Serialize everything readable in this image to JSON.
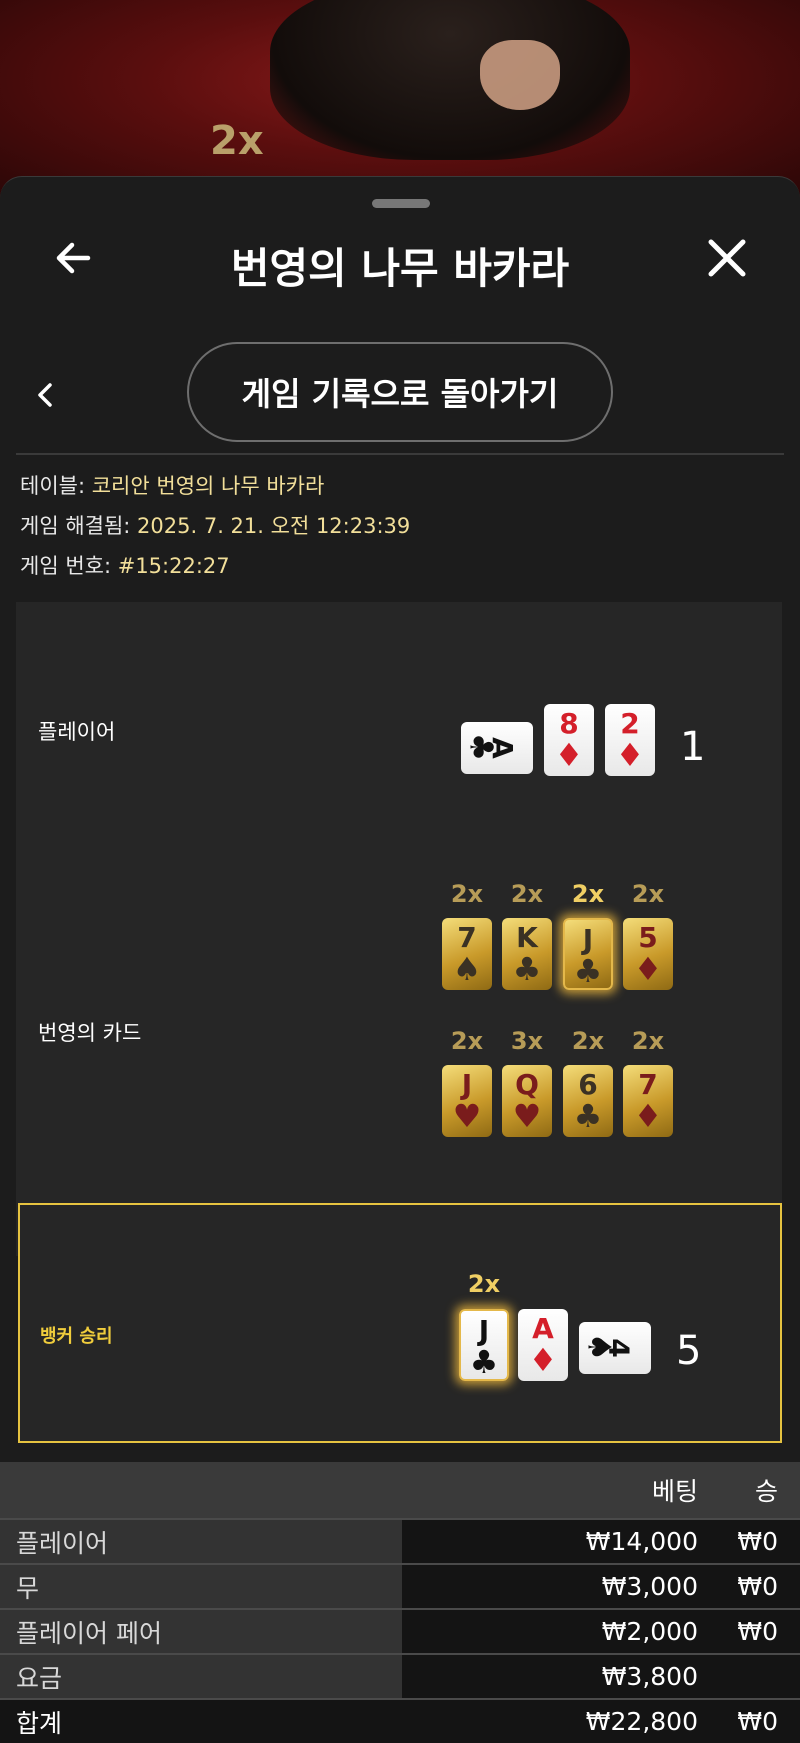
{
  "background": {
    "multiplier": "2x"
  },
  "header": {
    "title": "번영의 나무 바카라",
    "back_icon": "arrow-left-icon",
    "close_icon": "close-icon"
  },
  "nav": {
    "return_label": "게임 기록으로 돌아가기"
  },
  "info": {
    "table_label": "테이블:",
    "table_value": "코리안 번영의 나무 바카라",
    "resolved_label": "게임 해결됨:",
    "resolved_value": "2025. 7. 21. 오전 12:23:39",
    "game_no_label": "게임 번호:",
    "game_no_value": "#15:22:27"
  },
  "player": {
    "label": "플레이어",
    "cards": [
      {
        "rank": "A",
        "suit": "♣",
        "color": "black",
        "orientation": "side"
      },
      {
        "rank": "8",
        "suit": "♦",
        "color": "red"
      },
      {
        "rank": "2",
        "suit": "♦",
        "color": "red"
      }
    ],
    "score": "1"
  },
  "fortune": {
    "label": "번영의 카드",
    "row1": [
      {
        "mult": "2x",
        "rank": "7",
        "suit": "♠",
        "color": "black"
      },
      {
        "mult": "2x",
        "rank": "K",
        "suit": "♣",
        "color": "black"
      },
      {
        "mult": "2x",
        "rank": "J",
        "suit": "♣",
        "color": "black",
        "highlight": true
      },
      {
        "mult": "2x",
        "rank": "5",
        "suit": "♦",
        "color": "red"
      }
    ],
    "row2": [
      {
        "mult": "2x",
        "rank": "J",
        "suit": "♥",
        "color": "red"
      },
      {
        "mult": "3x",
        "rank": "Q",
        "suit": "♥",
        "color": "red"
      },
      {
        "mult": "2x",
        "rank": "6",
        "suit": "♣",
        "color": "black"
      },
      {
        "mult": "2x",
        "rank": "7",
        "suit": "♦",
        "color": "red"
      }
    ]
  },
  "banker": {
    "label": "뱅커 승리",
    "mult": "2x",
    "cards": [
      {
        "rank": "J",
        "suit": "♣",
        "color": "black",
        "highlight": true
      },
      {
        "rank": "A",
        "suit": "♦",
        "color": "red"
      },
      {
        "rank": "4",
        "suit": "♠",
        "color": "black",
        "orientation": "side"
      }
    ],
    "score": "5"
  },
  "bets": {
    "header_bet": "베팅",
    "header_win": "승",
    "rows": [
      {
        "label": "플레이어",
        "bet": "₩14,000",
        "win": "₩0"
      },
      {
        "label": "무",
        "bet": "₩3,000",
        "win": "₩0"
      },
      {
        "label": "플레이어 페어",
        "bet": "₩2,000",
        "win": "₩0"
      },
      {
        "label": "요금",
        "bet": "₩3,800",
        "win": ""
      }
    ],
    "total": {
      "label": "합계",
      "bet": "₩22,800",
      "win": "₩0"
    }
  },
  "colors": {
    "accent_gold": "#e6c340",
    "value_text": "#f2df9a",
    "panel_bg": "#1c1c1c"
  }
}
